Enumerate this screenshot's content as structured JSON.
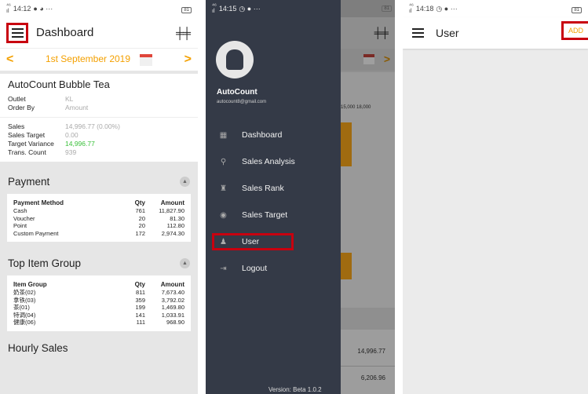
{
  "panel1": {
    "status": {
      "time": "14:12",
      "battery": "81"
    },
    "appbar": {
      "title": "Dashboard"
    },
    "datebar": {
      "date": "1st September 2019",
      "prev": "<",
      "next": ">"
    },
    "company": {
      "name": "AutoCount Bubble Tea",
      "outlet_label": "Outlet",
      "outlet_value": "KL",
      "order_label": "Order By",
      "order_value": "Amount",
      "sales_label": "Sales",
      "sales_value": "14,996.77 (0.00%)",
      "target_label": "Sales Target",
      "target_value": "0.00",
      "variance_label": "Target Variance",
      "variance_value": "14,996.77",
      "trans_label": "Trans. Count",
      "trans_value": "939"
    },
    "payment": {
      "title": "Payment",
      "headers": [
        "Payment Method",
        "Qty",
        "Amount"
      ],
      "rows": [
        [
          "Cash",
          "761",
          "11,827.90"
        ],
        [
          "Voucher",
          "20",
          "81.30"
        ],
        [
          "Point",
          "20",
          "112.80"
        ],
        [
          "Custom Payment",
          "172",
          "2,974.30"
        ]
      ]
    },
    "item_group": {
      "title": "Top Item Group",
      "headers": [
        "Item Group",
        "Qty",
        "Amount"
      ],
      "rows": [
        [
          "奶茶(02)",
          "811",
          "7,673.40"
        ],
        [
          "拿铁(03)",
          "359",
          "3,792.02"
        ],
        [
          "茶(01)",
          "199",
          "1,469.80"
        ],
        [
          "特调(04)",
          "141",
          "1,033.91"
        ],
        [
          "健康(06)",
          "111",
          "968.90"
        ]
      ]
    },
    "hourly": {
      "title": "Hourly Sales"
    }
  },
  "panel2": {
    "status": {
      "time": "14:15",
      "battery": "81"
    },
    "user": {
      "name": "AutoCount",
      "email": "autocount8@gmail.com"
    },
    "menu": [
      {
        "label": "Dashboard",
        "icon": "dashboard-icon"
      },
      {
        "label": "Sales Analysis",
        "icon": "sales-analysis-icon"
      },
      {
        "label": "Sales Rank",
        "icon": "sales-rank-icon"
      },
      {
        "label": "Sales Target",
        "icon": "sales-target-icon"
      },
      {
        "label": "User",
        "icon": "user-icon"
      },
      {
        "label": "Logout",
        "icon": "logout-icon"
      }
    ],
    "version": "Version: Beta 1.0.2",
    "behind": {
      "ticks": "15,000 18,000",
      "value1": "14,996.77",
      "value2": "6,206.96"
    }
  },
  "panel3": {
    "status": {
      "time": "14:18",
      "battery": "81"
    },
    "appbar": {
      "title": "User",
      "add_label": "ADD"
    }
  },
  "colors": {
    "accent": "#f4a000",
    "highlight": "#c8000f",
    "drawer": "#343a47",
    "positive": "#3ac03a"
  }
}
